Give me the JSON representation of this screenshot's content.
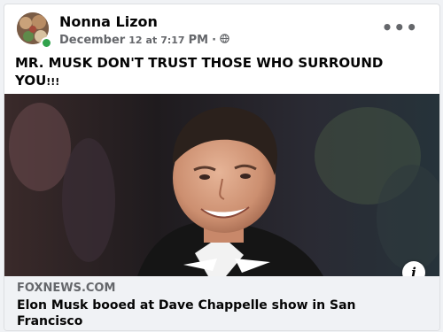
{
  "post": {
    "author": "Nonna Lizon",
    "date": "December",
    "day": "12",
    "at": "at",
    "time": "7:17",
    "meridiem": "PM",
    "separator": "·",
    "privacy_icon": "globe-icon",
    "more_icon": "more-options-icon",
    "more_label": "•••",
    "caption": "MR. MUSK DON'T TRUST THOSE WHO SURROUND YOU",
    "caption_suffix": "!!!"
  },
  "link": {
    "domain": "FOXNEWS.COM",
    "title": "Elon Musk booed at Dave Chappelle show in San Francisco",
    "info_label": "i"
  },
  "colors": {
    "online": "#31a24c",
    "background": "#f0f2f5",
    "meta_text": "#65676b"
  }
}
